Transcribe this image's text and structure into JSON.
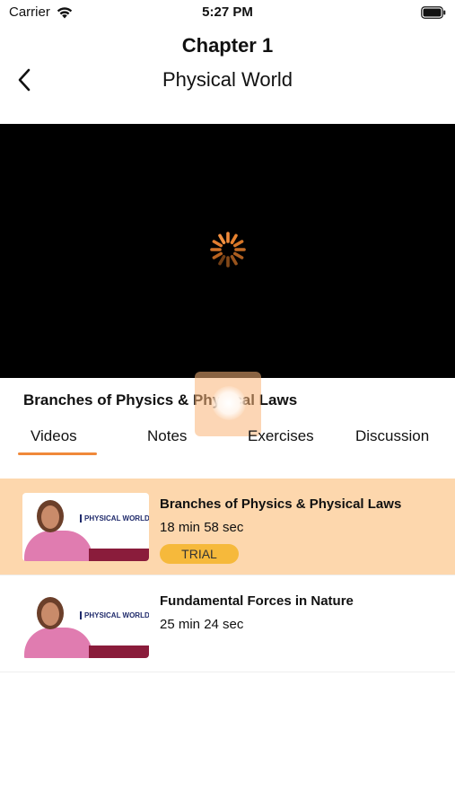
{
  "status_bar": {
    "carrier": "Carrier",
    "time": "5:27 PM",
    "wifi_icon": "wifi-icon",
    "battery_icon": "battery-icon"
  },
  "header": {
    "chapter": "Chapter 1",
    "title": "Physical World",
    "back_icon": "chevron-left-icon"
  },
  "player": {
    "state_icon": "loading-spinner-icon"
  },
  "current_video": {
    "title": "Branches of Physics & Physical Laws"
  },
  "tabs": [
    {
      "label": "Videos",
      "active": true
    },
    {
      "label": "Notes",
      "active": false
    },
    {
      "label": "Exercises",
      "active": false
    },
    {
      "label": "Discussion",
      "active": false
    }
  ],
  "videos": [
    {
      "title": "Branches of Physics & Physical Laws",
      "duration": "18 min 58 sec",
      "badge": "TRIAL",
      "thumbnail_label": "PHYSICAL WORLD",
      "active": true
    },
    {
      "title": "Fundamental Forces in Nature",
      "duration": "25 min 24 sec",
      "badge": "",
      "thumbnail_label": "PHYSICAL WORLD",
      "active": false
    }
  ],
  "colors": {
    "accent": "#f0893a",
    "active_row": "#fdd7ad",
    "trial_badge": "#f6b93b",
    "player_bg": "#000000"
  }
}
